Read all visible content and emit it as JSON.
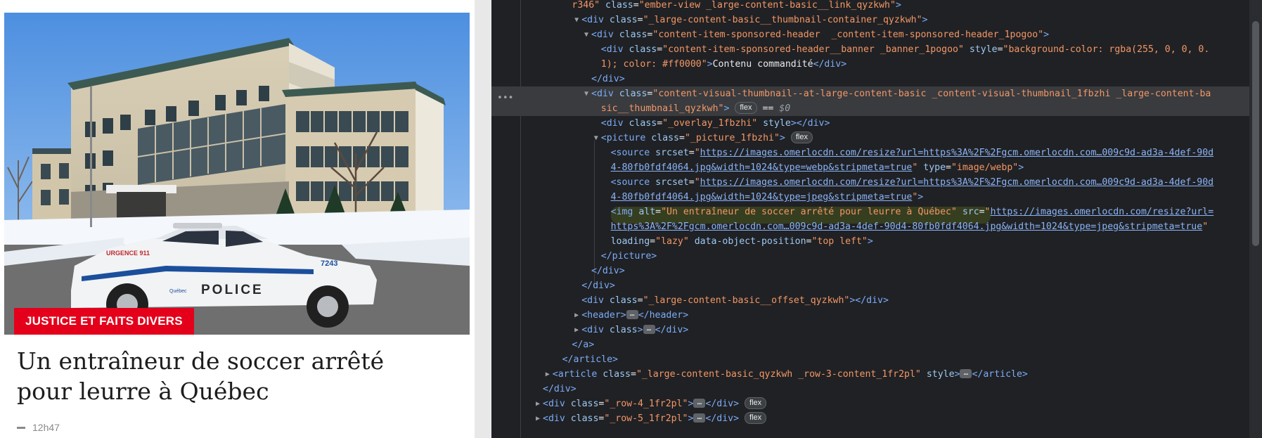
{
  "article": {
    "category": "JUSTICE ET FAITS DIVERS",
    "headline": "Un entraîneur de soccer arrêté pour leurre à Québec",
    "time": "12h47",
    "image_alt": "Un entraîneur de soccer arrêté pour leurre à Québec",
    "car": {
      "urgence_text": "URGENCE 911",
      "police_text": "POLICE",
      "unit_number": "7243",
      "city_text": "Québec"
    }
  },
  "devtools": {
    "lines": [
      {
        "depth": 8,
        "html": "<span class=\"av\">r346\"</span> <span class=\"an\">class</span>=<span class=\"av\">\"ember-view _large-content-basic__link_qyzkwh\"</span><span class=\"t\">&gt;</span>"
      },
      {
        "depth": 9,
        "tw": "open",
        "html": "<span class=\"t\">&lt;div</span> <span class=\"an\">class</span>=<span class=\"av\">\"_large-content-basic__thumbnail-container_qyzkwh\"</span><span class=\"t\">&gt;</span>"
      },
      {
        "depth": 10,
        "tw": "open",
        "html": "<span class=\"t\">&lt;div</span> <span class=\"an\">class</span>=<span class=\"av\">\"content-item-sponsored-header  _content-item-sponsored-header_1pogoo\"</span><span class=\"t\">&gt;</span>"
      },
      {
        "depth": 11,
        "html": "<span class=\"t\">&lt;div</span> <span class=\"an\">class</span>=<span class=\"av\">\"content-item-sponsored-header__banner _banner_1pogoo\"</span> <span class=\"an\">style</span>=<span class=\"av\">\"background-color: rgba(255, 0, 0, 0.</span>"
      },
      {
        "depth": 11,
        "html": "<span class=\"av\">1); color: #ff0000\"</span><span class=\"t\">&gt;</span><span class=\"tx\">Contenu commandité</span><span class=\"t\">&lt;/div&gt;</span>"
      },
      {
        "depth": 10,
        "html": "<span class=\"t\">&lt;/div&gt;</span>"
      },
      {
        "depth": 10,
        "tw": "open",
        "sel": true,
        "html": "<span class=\"t\">&lt;div</span> <span class=\"an\">class</span>=<span class=\"av\">\"content-visual-thumbnail--at-large-content-basic _content-visual-thumbnail_1fbzhi _large-content-ba</span>"
      },
      {
        "depth": 11,
        "sel": true,
        "html": "<span class=\"av\">sic__thumbnail_qyzkwh\"</span><span class=\"t\">&gt;</span> <span class=\"badge\">flex</span> <span class=\"tx\">==</span> <span class=\"dim\">$0</span>"
      },
      {
        "depth": 11,
        "html": "<span class=\"t\">&lt;div</span> <span class=\"an\">class</span>=<span class=\"av\">\"_overlay_1fbzhi\"</span> <span class=\"an\">style</span><span class=\"t\">&gt;&lt;/div&gt;</span>"
      },
      {
        "depth": 11,
        "tw": "open",
        "html": "<span class=\"t\">&lt;picture</span> <span class=\"an\">class</span>=<span class=\"av\">\"_picture_1fbzhi\"</span><span class=\"t\">&gt;</span> <span class=\"badge\">flex</span>"
      },
      {
        "depth": 12,
        "html": "<span class=\"t\">&lt;source</span> <span class=\"an\">srcset</span>=<span class=\"av\">\"</span><span class=\"lk\">https://images.omerlocdn.com/resize?url=https%3A%2F%2Fgcm.omerlocdn.com…009c9d-ad3a-4def-90d</span>"
      },
      {
        "depth": 12,
        "html": "<span class=\"lk\">4-80fb0fdf4064.jpg&amp;width=1024&amp;type=webp&amp;stripmeta=true</span><span class=\"av\">\"</span> <span class=\"an\">type</span>=<span class=\"av\">\"image/webp\"</span><span class=\"t\">&gt;</span>"
      },
      {
        "depth": 12,
        "html": "<span class=\"t\">&lt;source</span> <span class=\"an\">srcset</span>=<span class=\"av\">\"</span><span class=\"lk\">https://images.omerlocdn.com/resize?url=https%3A%2F%2Fgcm.omerlocdn.com…009c9d-ad3a-4def-90d</span>"
      },
      {
        "depth": 12,
        "html": "<span class=\"lk\">4-80fb0fdf4064.jpg&amp;width=1024&amp;type=jpeg&amp;stripmeta=true</span><span class=\"av\">\"</span><span class=\"t\">&gt;</span>"
      },
      {
        "depth": 12,
        "html": "<span class=\"t\">&lt;img</span> <span class=\"an\">alt</span>=<span class=\"av\">\"Un entraîneur de soccer arrêté pour leurre à Québec\"</span> <span class=\"an\">src</span>=<span class=\"av\">\"</span><span class=\"lk\">https://images.omerlocdn.com/resize?url=</span>"
      },
      {
        "depth": 12,
        "html": "<span class=\"lk\">https%3A%2F%2Fgcm.omerlocdn.com…009c9d-ad3a-4def-90d4-80fb0fdf4064.jpg&amp;width=1024&amp;type=jpeg&amp;stripmeta=true</span><span class=\"av\">\"</span>"
      },
      {
        "depth": 12,
        "html": "<span class=\"an\">loading</span>=<span class=\"av\">\"lazy\"</span> <span class=\"an\">data-object-position</span>=<span class=\"av\">\"top left\"</span><span class=\"t\">&gt;</span>"
      },
      {
        "depth": 11,
        "html": "<span class=\"t\">&lt;/picture&gt;</span>"
      },
      {
        "depth": 10,
        "html": "<span class=\"t\">&lt;/div&gt;</span>"
      },
      {
        "depth": 9,
        "html": "<span class=\"t\">&lt;/div&gt;</span>"
      },
      {
        "depth": 9,
        "html": "<span class=\"t\">&lt;div</span> <span class=\"an\">class</span>=<span class=\"av\">\"_large-content-basic__offset_qyzkwh\"</span><span class=\"t\">&gt;&lt;/div&gt;</span>"
      },
      {
        "depth": 9,
        "tw": "closed",
        "html": "<span class=\"t\">&lt;header&gt;</span><span class=\"ell\">…</span><span class=\"t\">&lt;/header&gt;</span>"
      },
      {
        "depth": 9,
        "tw": "closed",
        "html": "<span class=\"t\">&lt;div</span> <span class=\"an\">class</span><span class=\"t\">&gt;</span><span class=\"ell\">…</span><span class=\"t\">&lt;/div&gt;</span>"
      },
      {
        "depth": 8,
        "html": "<span class=\"t\">&lt;/a&gt;</span>"
      },
      {
        "depth": 7,
        "html": "<span class=\"t\">&lt;/article&gt;</span>"
      },
      {
        "depth": 6,
        "tw": "closed",
        "html": "<span class=\"t\">&lt;article</span> <span class=\"an\">class</span>=<span class=\"av\">\"_large-content-basic_qyzkwh _row-3-content_1fr2pl\"</span> <span class=\"an\">style</span><span class=\"t\">&gt;</span><span class=\"ell\">…</span><span class=\"t\">&lt;/article&gt;</span>"
      },
      {
        "depth": 5,
        "html": "<span class=\"t\">&lt;/div&gt;</span>"
      },
      {
        "depth": 5,
        "tw": "closed",
        "html": "<span class=\"t\">&lt;div</span> <span class=\"an\">class</span>=<span class=\"av\">\"_row-4_1fr2pl\"</span><span class=\"t\">&gt;</span><span class=\"ell\">…</span><span class=\"t\">&lt;/div&gt;</span> <span class=\"badge\">flex</span>"
      },
      {
        "depth": 5,
        "tw": "closed",
        "html": "<span class=\"t\">&lt;div</span> <span class=\"an\">class</span>=<span class=\"av\">\"_row-5_1fr2pl\"</span><span class=\"t\">&gt;</span><span class=\"ell\">…</span><span class=\"t\">&lt;/div&gt;</span> <span class=\"badge\">flex</span>"
      }
    ]
  }
}
